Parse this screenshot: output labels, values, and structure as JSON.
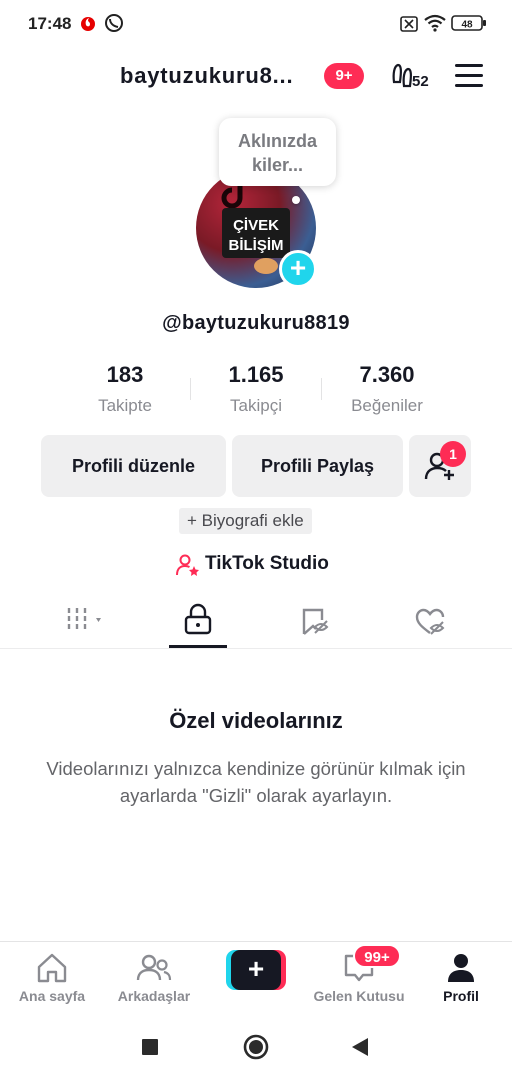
{
  "status_bar": {
    "time": "17:48",
    "battery": "48"
  },
  "header": {
    "username_title": "baytuzukuru8...",
    "notifications_badge": "9+",
    "streak_count": "52"
  },
  "profile": {
    "note_text": "Aklınızda kiler...",
    "avatar_text": "ÇİVEK BİLİŞİM",
    "handle": "@baytuzukuru8819"
  },
  "stats": [
    {
      "value": "183",
      "label": "Takipte"
    },
    {
      "value": "1.165",
      "label": "Takipçi"
    },
    {
      "value": "7.360",
      "label": "Beğeniler"
    }
  ],
  "actions": {
    "edit_profile": "Profili düzenle",
    "share_profile": "Profili Paylaş",
    "friend_requests_badge": "1"
  },
  "bio_button": "+ Biyografi ekle",
  "studio_label": "TikTok Studio",
  "tabs": [
    "videos",
    "private",
    "reposts",
    "liked"
  ],
  "empty_state": {
    "title": "Özel videolarınız",
    "description": "Videolarınızı yalnızca kendinize görünür kılmak için ayarlarda \"Gizli\" olarak ayarlayın."
  },
  "bottom_nav": {
    "home": "Ana sayfa",
    "friends": "Arkadaşlar",
    "inbox": "Gelen Kutusu",
    "inbox_badge": "99+",
    "profile": "Profil"
  },
  "colors": {
    "accent_red": "#fe2c55",
    "accent_cyan": "#20d5ec",
    "text_primary": "#161823"
  }
}
